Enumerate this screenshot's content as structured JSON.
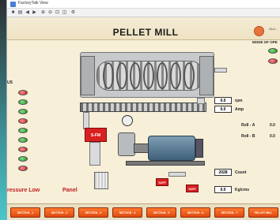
{
  "window": {
    "title": "FactoryTalk View"
  },
  "toolbar": {
    "icons": [
      "save-icon",
      "print-icon",
      "back-icon",
      "forward-icon",
      "zoom-in-icon",
      "zoom-out-icon",
      "zoom-fit-icon",
      "zoom-window-icon",
      "settings-icon"
    ]
  },
  "hmi": {
    "title": "PELLET MILL",
    "logo_text": "GUJ...",
    "mode_title": "MODE OF OPE",
    "left_label": "US",
    "feeder_motor_label": "S-FM",
    "rpm_value": "0.0",
    "rpm_unit": "rpm",
    "amp_value": "0.0",
    "amp_unit": "Amp",
    "roll_a_label": "Roll - A",
    "roll_a_value": "0.0",
    "roll_b_label": "Roll - B",
    "roll_b_value": "0.0",
    "count_value": "2028",
    "count_label": "Count",
    "kg_value": "0.0",
    "kg_label": "Kg/cms",
    "gate_1_label": "SOFF",
    "gate_2_label": "SOFF",
    "alarm_text": "ressure Low",
    "alarm_text_2": "Panel",
    "colors": {
      "green_led": "#1e8c1e",
      "red_led": "#c21d1d",
      "nav_button": "#e04a10",
      "background": "#f7efd8"
    }
  },
  "nav": {
    "buttons": [
      "SECTION - 1",
      "SECTION - 2",
      "SECTION - 3",
      "SECTION - 4",
      "SECTION - 5",
      "SECTION - 6",
      "SECTION - 7",
      "PELLET MILL"
    ]
  }
}
